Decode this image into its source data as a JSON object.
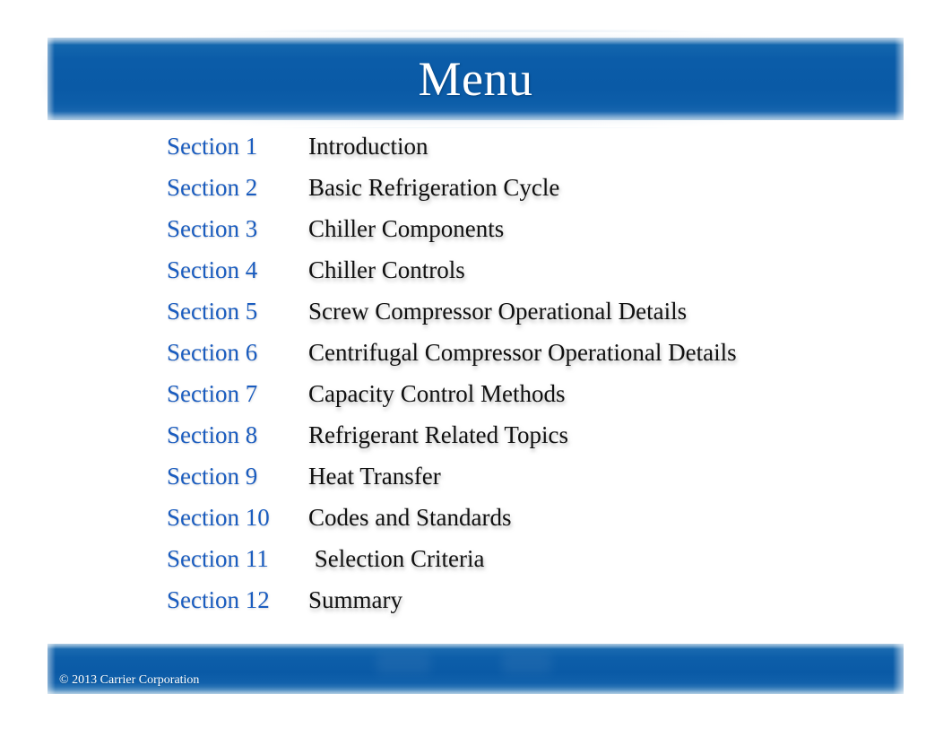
{
  "slide": {
    "background_color": "#ffffff",
    "banner_color": "#0a5aa6",
    "section_label_color": "#1a5cbf",
    "section_title_color": "#101010"
  },
  "header": {
    "title": "Menu"
  },
  "menu": {
    "rows": [
      {
        "label": "Section 1",
        "title": "Introduction"
      },
      {
        "label": "Section 2",
        "title": "Basic Refrigeration Cycle"
      },
      {
        "label": "Section 3",
        "title": "Chiller Components"
      },
      {
        "label": "Section 4",
        "title": "Chiller Controls"
      },
      {
        "label": "Section 5",
        "title": "Screw Compressor Operational Details"
      },
      {
        "label": "Section 6",
        "title": "Centrifugal Compressor Operational Details"
      },
      {
        "label": "Section 7",
        "title": "Capacity Control Methods"
      },
      {
        "label": "Section 8",
        "title": "Refrigerant Related Topics"
      },
      {
        "label": "Section 9",
        "title": "Heat Transfer"
      },
      {
        "label": "Section 10",
        "title": "Codes and Standards"
      },
      {
        "label": "Section 11",
        "title": " Selection Criteria"
      },
      {
        "label": "Section 12",
        "title": "Summary"
      }
    ]
  },
  "footer": {
    "copyright": "© 2013 Carrier Corporation"
  }
}
